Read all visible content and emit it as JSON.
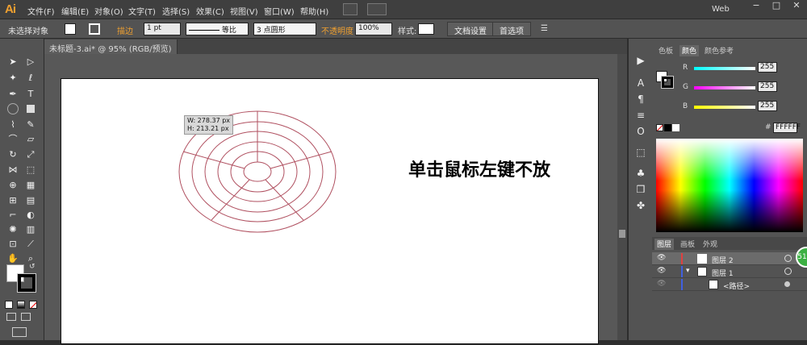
{
  "app": {
    "logo": "Ai",
    "workspace": "Web"
  },
  "menu": [
    "文件(F)",
    "编辑(E)",
    "对象(O)",
    "文字(T)",
    "选择(S)",
    "效果(C)",
    "视图(V)",
    "窗口(W)",
    "帮助(H)"
  ],
  "window_controls": {
    "minimize": "−",
    "restore": "□",
    "close": "✕"
  },
  "control_bar": {
    "selection": "未选择对象",
    "stroke_label": "描边",
    "stroke_weight": "1 pt",
    "stroke_profile": "等比",
    "brush": "3 点圆形",
    "opacity_label": "不透明度",
    "opacity_value": "100%",
    "style_label": "样式:",
    "doc_setup": "文档设置",
    "preferences": "首选项"
  },
  "document": {
    "tab": "未标题-3.ai* @ 95% (RGB/预览)"
  },
  "canvas": {
    "tooltip_w": "W: 278.37 px",
    "tooltip_h": "H: 213.21 px",
    "annotation": "单击鼠标左键不放"
  },
  "color_panel": {
    "tabs": [
      "色板",
      "颜色",
      "颜色参考"
    ],
    "r_label": "R",
    "g_label": "G",
    "b_label": "B",
    "r": "255",
    "g": "255",
    "b": "255",
    "hex_prefix": "#",
    "hex": "FFFFFF"
  },
  "layers_panel": {
    "tabs": [
      "图层",
      "画板",
      "外观"
    ],
    "layers": [
      {
        "name": "图层 2"
      },
      {
        "name": "图层 1"
      },
      {
        "name": "<路径>"
      }
    ],
    "badge": "51"
  },
  "colors": {
    "accent": "#f0a030",
    "stroke": "#b05060"
  }
}
